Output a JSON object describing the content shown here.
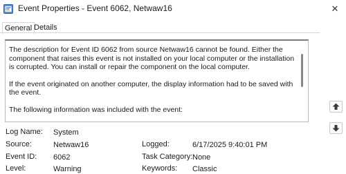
{
  "window": {
    "title": "Event Properties - Event 6062, Netwaw16",
    "close_glyph": "✕"
  },
  "tabs": [
    {
      "label": "General",
      "selected": true
    },
    {
      "label": "Details",
      "selected": false
    }
  ],
  "description": {
    "paragraphs": [
      "The description for Event ID 6062 from source Netwaw16 cannot be found. Either the component that raises this event is not installed on your local computer or the installation is corrupted. You can install or repair the component on the local computer.",
      "If the event originated on another computer, the display information had to be saved with the event.",
      "The following information was included with the event:"
    ]
  },
  "fields": {
    "log_name": {
      "label": "Log Name:",
      "value": "System"
    },
    "source": {
      "label": "Source:",
      "value": "Netwaw16"
    },
    "event_id": {
      "label": "Event ID:",
      "value": "6062"
    },
    "level": {
      "label": "Level:",
      "value": "Warning"
    },
    "logged": {
      "label": "Logged:",
      "value": "6/17/2025 9:40:01 PM"
    },
    "task_category": {
      "label": "Task Category:",
      "value": "None"
    },
    "keywords": {
      "label": "Keywords:",
      "value": "Classic"
    }
  },
  "nav": {
    "up_icon": "arrow-up-icon",
    "down_icon": "arrow-down-icon"
  }
}
